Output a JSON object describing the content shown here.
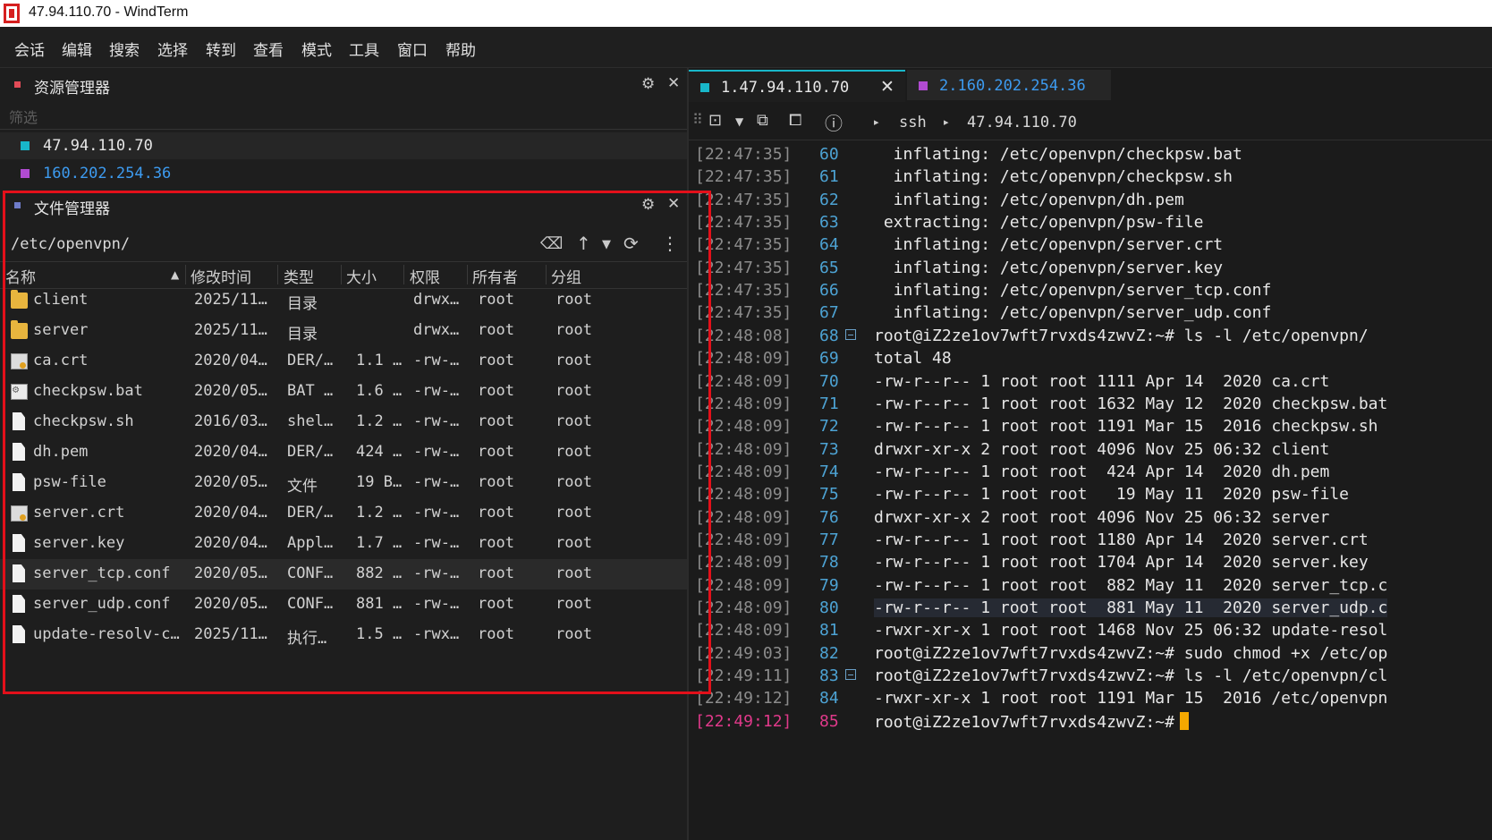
{
  "window": {
    "title": "47.94.110.70 - WindTerm"
  },
  "menu": [
    "会话",
    "编辑",
    "搜索",
    "选择",
    "转到",
    "查看",
    "模式",
    "工具",
    "窗口",
    "帮助"
  ],
  "explorer": {
    "title": "资源管理器",
    "filter_placeholder": "筛选",
    "sessions": [
      {
        "label": "47.94.110.70",
        "color": "#18b7c9"
      },
      {
        "label": "160.202.254.36",
        "color": "#b14bd1"
      }
    ]
  },
  "file_manager": {
    "title": "文件管理器",
    "path": "/etc/openvpn/",
    "columns": [
      "名称",
      "修改时间",
      "类型",
      "大小",
      "权限",
      "所有者",
      "分组"
    ],
    "rows": [
      {
        "icon": "folder-icon",
        "name": "client",
        "mtime": "2025/11…",
        "type": "目录",
        "size": "",
        "perm": "drwx…",
        "owner": "root",
        "group": "root"
      },
      {
        "icon": "folder-icon",
        "name": "server",
        "mtime": "2025/11…",
        "type": "目录",
        "size": "",
        "perm": "drwx…",
        "owner": "root",
        "group": "root"
      },
      {
        "icon": "certificate-icon",
        "name": "ca.crt",
        "mtime": "2020/04…",
        "type": "DER/…",
        "size": "1.1 …",
        "perm": "-rw-…",
        "owner": "root",
        "group": "root"
      },
      {
        "icon": "batch-file-icon",
        "name": "checkpsw.bat",
        "mtime": "2020/05…",
        "type": "BAT …",
        "size": "1.6 …",
        "perm": "-rw-…",
        "owner": "root",
        "group": "root"
      },
      {
        "icon": "file-icon",
        "name": "checkpsw.sh",
        "mtime": "2016/03…",
        "type": "shel…",
        "size": "1.2 …",
        "perm": "-rw-…",
        "owner": "root",
        "group": "root"
      },
      {
        "icon": "file-icon",
        "name": "dh.pem",
        "mtime": "2020/04…",
        "type": "DER/…",
        "size": "424 …",
        "perm": "-rw-…",
        "owner": "root",
        "group": "root"
      },
      {
        "icon": "file-icon",
        "name": "psw-file",
        "mtime": "2020/05…",
        "type": "文件",
        "size": "19 B…",
        "perm": "-rw-…",
        "owner": "root",
        "group": "root"
      },
      {
        "icon": "certificate-icon",
        "name": "server.crt",
        "mtime": "2020/04…",
        "type": "DER/…",
        "size": "1.2 …",
        "perm": "-rw-…",
        "owner": "root",
        "group": "root"
      },
      {
        "icon": "file-icon",
        "name": "server.key",
        "mtime": "2020/04…",
        "type": "Appl…",
        "size": "1.7 …",
        "perm": "-rw-…",
        "owner": "root",
        "group": "root"
      },
      {
        "icon": "file-icon",
        "name": "server_tcp.conf",
        "mtime": "2020/05…",
        "type": "CONF…",
        "size": "882 …",
        "perm": "-rw-…",
        "owner": "root",
        "group": "root"
      },
      {
        "icon": "file-icon",
        "name": "server_udp.conf",
        "mtime": "2020/05…",
        "type": "CONF…",
        "size": "881 …",
        "perm": "-rw-…",
        "owner": "root",
        "group": "root"
      },
      {
        "icon": "file-icon",
        "name": "update-resolv-c…",
        "mtime": "2025/11…",
        "type": "执行…",
        "size": "1.5 …",
        "perm": "-rwx…",
        "owner": "root",
        "group": "root"
      }
    ]
  },
  "terminal": {
    "tabs": [
      {
        "label": "1.47.94.110.70",
        "color": "#18b7c9",
        "active": true
      },
      {
        "label": "2.160.202.254.36",
        "color": "#b14bd1",
        "active": false
      }
    ],
    "breadcrumb": [
      "ssh",
      "47.94.110.70"
    ],
    "lines": [
      {
        "ts": "[22:47:35]",
        "n": "60",
        "text": "  inflating: /etc/openvpn/checkpsw.bat"
      },
      {
        "ts": "[22:47:35]",
        "n": "61",
        "text": "  inflating: /etc/openvpn/checkpsw.sh"
      },
      {
        "ts": "[22:47:35]",
        "n": "62",
        "text": "  inflating: /etc/openvpn/dh.pem"
      },
      {
        "ts": "[22:47:35]",
        "n": "63",
        "text": " extracting: /etc/openvpn/psw-file"
      },
      {
        "ts": "[22:47:35]",
        "n": "64",
        "text": "  inflating: /etc/openvpn/server.crt"
      },
      {
        "ts": "[22:47:35]",
        "n": "65",
        "text": "  inflating: /etc/openvpn/server.key"
      },
      {
        "ts": "[22:47:35]",
        "n": "66",
        "text": "  inflating: /etc/openvpn/server_tcp.conf"
      },
      {
        "ts": "[22:47:35]",
        "n": "67",
        "text": "  inflating: /etc/openvpn/server_udp.conf"
      },
      {
        "ts": "[22:48:08]",
        "n": "68",
        "text": "root@iZ2ze1ov7wft7rvxds4zwvZ:~# ls -l /etc/openvpn/"
      },
      {
        "ts": "[22:48:09]",
        "n": "69",
        "text": "total 48"
      },
      {
        "ts": "[22:48:09]",
        "n": "70",
        "text": "-rw-r--r-- 1 root root 1111 Apr 14  2020 ca.crt"
      },
      {
        "ts": "[22:48:09]",
        "n": "71",
        "text": "-rw-r--r-- 1 root root 1632 May 12  2020 checkpsw.bat"
      },
      {
        "ts": "[22:48:09]",
        "n": "72",
        "text": "-rw-r--r-- 1 root root 1191 Mar 15  2016 checkpsw.sh"
      },
      {
        "ts": "[22:48:09]",
        "n": "73",
        "text": "drwxr-xr-x 2 root root 4096 Nov 25 06:32 client"
      },
      {
        "ts": "[22:48:09]",
        "n": "74",
        "text": "-rw-r--r-- 1 root root  424 Apr 14  2020 dh.pem"
      },
      {
        "ts": "[22:48:09]",
        "n": "75",
        "text": "-rw-r--r-- 1 root root   19 May 11  2020 psw-file"
      },
      {
        "ts": "[22:48:09]",
        "n": "76",
        "text": "drwxr-xr-x 2 root root 4096 Nov 25 06:32 server"
      },
      {
        "ts": "[22:48:09]",
        "n": "77",
        "text": "-rw-r--r-- 1 root root 1180 Apr 14  2020 server.crt"
      },
      {
        "ts": "[22:48:09]",
        "n": "78",
        "text": "-rw-r--r-- 1 root root 1704 Apr 14  2020 server.key"
      },
      {
        "ts": "[22:48:09]",
        "n": "79",
        "text": "-rw-r--r-- 1 root root  882 May 11  2020 server_tcp.c"
      },
      {
        "ts": "[22:48:09]",
        "n": "80",
        "text": "-rw-r--r-- 1 root root  881 May 11  2020 server_udp.c"
      },
      {
        "ts": "[22:48:09]",
        "n": "81",
        "text": "-rwxr-xr-x 1 root root 1468 Nov 25 06:32 update-resol"
      },
      {
        "ts": "[22:49:03]",
        "n": "82",
        "text": "root@iZ2ze1ov7wft7rvxds4zwvZ:~# sudo chmod +x /etc/op"
      },
      {
        "ts": "[22:49:11]",
        "n": "83",
        "text": "root@iZ2ze1ov7wft7rvxds4zwvZ:~# ls -l /etc/openvpn/cl"
      },
      {
        "ts": "[22:49:12]",
        "n": "84",
        "text": "-rwxr-xr-x 1 root root 1191 Mar 15  2016 /etc/openvpn"
      },
      {
        "ts": "[22:49:12]",
        "n": "85",
        "text": "root@iZ2ze1ov7wft7rvxds4zwvZ:~#"
      }
    ]
  }
}
